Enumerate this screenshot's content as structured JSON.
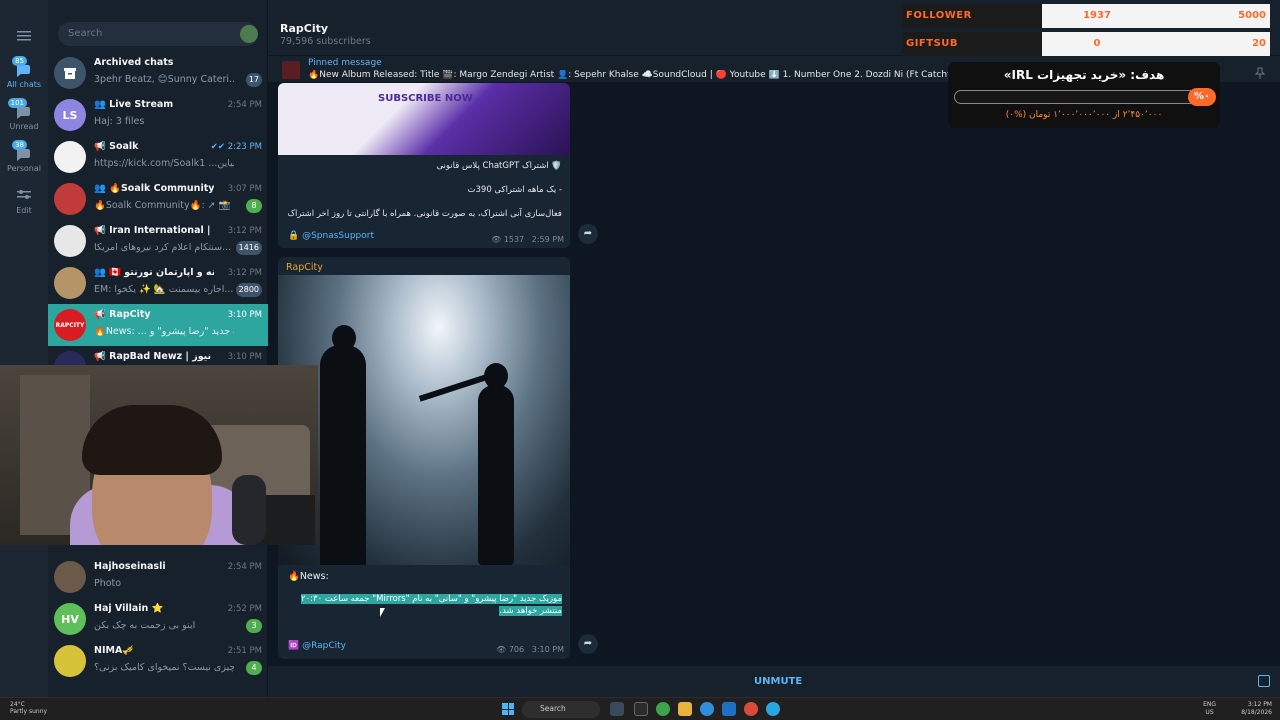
{
  "rail": {
    "items": [
      {
        "label": "All chats",
        "badge": "85"
      },
      {
        "label": "Unread",
        "badge": "101"
      },
      {
        "label": "Personal",
        "badge": "38"
      },
      {
        "label": "Edit",
        "badge": ""
      }
    ]
  },
  "search": {
    "placeholder": "Search"
  },
  "chats": [
    {
      "name": "Archived chats",
      "preview": "3pehr Beatz, 😊Sunny Cateri...",
      "time": "",
      "badge": "17"
    },
    {
      "name": "👥 Live Stream",
      "preview": "Haj: 3 files",
      "time": "2:54 PM",
      "badge": "",
      "initials": "LS"
    },
    {
      "name": "📢 Soalk",
      "preview": "https://kick.com/Soalk1 ...بیاین",
      "time": "✔✔ 2:23 PM",
      "badge": ""
    },
    {
      "name": "👥 🔥Soalk Community🔥",
      "preview": "🔥Soalk Community🔥: ➚ 📸",
      "time": "3:07 PM",
      "badge": "8"
    },
    {
      "name": "📢 Iran International | ایران",
      "preview": "سنتکام اعلام کرد نیروهای آمریکا...",
      "time": "3:12 PM",
      "badge": "1416"
    },
    {
      "name": "👥 🇨🇦 خانه و آپارتمان تورنتو 🇨🇦",
      "preview": "EM: اجاره بیسمنت 🏡 ✨ یکخوا...",
      "time": "3:12 PM",
      "badge": "2800"
    },
    {
      "name": "📢 RapCity",
      "preview": "🔥News: ... موزیک جدید \"رضا پیشرو\" و",
      "time": "3:10 PM",
      "badge": ""
    },
    {
      "name": "📢 RapBad Newz | رپ بد نیوز",
      "preview": "",
      "time": "3:10 PM",
      "badge": ""
    },
    {
      "name": "Hajhoseinasli",
      "preview": "Photo",
      "time": "2:54 PM",
      "badge": ""
    },
    {
      "name": "Haj Villain ⭐",
      "preview": "اینو بی زحمت به چک بکن",
      "time": "2:52 PM",
      "badge": "3",
      "initials": "HV"
    },
    {
      "name": "NIMA🎺",
      "preview": "کمکی چیزی نیست؟ نمیخوای کامیک بزنی؟",
      "time": "2:51 PM",
      "badge": "4"
    }
  ],
  "header": {
    "title": "RapCity",
    "subtitle": "79,596 subscribers"
  },
  "pinned": {
    "label": "Pinned message",
    "text": "🔥New Album Released: Title 🎬: Margo Zendegi  Artist 👤: Sepehr Khalse  ☁️SoundCloud | 🔴 Youtube ⬇️  1. Number One 2. Dozdi Ni (Ft CatchyBe"
  },
  "post1": {
    "banner": "SUBSCRIBE NOW",
    "lines": [
      "🛡️ اشتراک ChatGPT پلاس قانونی",
      "- یک ماهه اشتراکی 390ت",
      "فعال‌سازی آنی اشتراک، به صورت قانونی. همراه با گارانتی تا روز اخر اشتراک"
    ],
    "link": "🔒 @SpnasSupport",
    "views": "1537",
    "time": "2:59 PM"
  },
  "post2": {
    "author": "RapCity",
    "news": "🔥News:",
    "highlight": "موزیک جدید \"رضا پیشرو\" و \"سانی\" به نام \"Mirrors\" جمعه ساعت ۲۰:۳۰ منتشر خواهد شد.",
    "tag": "🆔 @RapCity",
    "views": "706",
    "time": "3:10 PM"
  },
  "bottom": {
    "unmute": "UNMUTE"
  },
  "taskbar": {
    "weather_temp": "24°C",
    "weather_desc": "Partly sunny",
    "search": "Search",
    "lang1": "ENG",
    "lang2": "US",
    "time": "3:12 PM",
    "date": "8/18/2026"
  },
  "overlay": {
    "goals": [
      {
        "label": "FOLLOWER",
        "current": "1937",
        "target": "5000"
      },
      {
        "label": "GIFTSUB",
        "current": "0",
        "target": "20"
      }
    ],
    "donation_title": "هدف: «خرید تجهیزات IRL»",
    "donation_pct": "%۰",
    "donation_sub": "۲٬۴۵۰٬۰۰۰ از ۱٬۰۰۰٬۰۰۰٬۰۰۰ تومان (%۰)"
  },
  "colors": {
    "accent": "#5eb5f7",
    "active_chat": "#2ea6a0",
    "overlay_orange": "#ff6a2a"
  }
}
